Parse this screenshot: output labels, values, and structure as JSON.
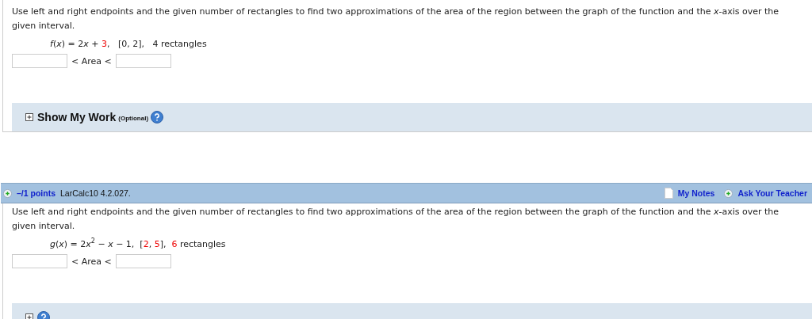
{
  "questions": [
    {
      "prompt": "Use left and right endpoints and the given number of rectangles to find two approximations of the area of the region between the graph of the function and the *x*-axis over the given interval.",
      "formula": [
        {
          "text": "f",
          "kind": "italic"
        },
        {
          "text": "(",
          "kind": "plain"
        },
        {
          "text": "x",
          "kind": "italic"
        },
        {
          "text": ") = 2",
          "kind": "plain"
        },
        {
          "text": "x",
          "kind": "italic"
        },
        {
          "text": " + ",
          "kind": "plain"
        },
        {
          "text": "3",
          "kind": "red"
        },
        {
          "text": ",   [0, 2],   4 rectangles",
          "kind": "plain"
        }
      ],
      "inequality": "< Area <",
      "show_work": {
        "label": "Show My Work",
        "note": "(Optional)",
        "expanded": false
      }
    },
    {
      "header": {
        "points": "–/1 points",
        "source": "LarCalc10 4.2.027.",
        "notes": "My Notes",
        "ask": "Ask Your Teacher"
      },
      "prompt": "Use left and right endpoints and the given number of rectangles to find two approximations of the area of the region between the graph of the function and the *x*-axis over the given interval.",
      "formula": [
        {
          "text": "g",
          "kind": "italic"
        },
        {
          "text": "(",
          "kind": "plain"
        },
        {
          "text": "x",
          "kind": "italic"
        },
        {
          "text": ") = 2",
          "kind": "plain"
        },
        {
          "text": "x",
          "kind": "italic"
        },
        {
          "text": "2",
          "kind": "sup"
        },
        {
          "text": " − ",
          "kind": "plain"
        },
        {
          "text": "x",
          "kind": "italic"
        },
        {
          "text": " − 1,  [",
          "kind": "plain"
        },
        {
          "text": "2",
          "kind": "red"
        },
        {
          "text": ", ",
          "kind": "plain"
        },
        {
          "text": "5",
          "kind": "red"
        },
        {
          "text": "],  ",
          "kind": "plain"
        },
        {
          "text": "6",
          "kind": "red"
        },
        {
          "text": " rectangles",
          "kind": "plain"
        }
      ],
      "inequality": "< Area <",
      "show_work": {
        "expanded": false
      }
    }
  ]
}
